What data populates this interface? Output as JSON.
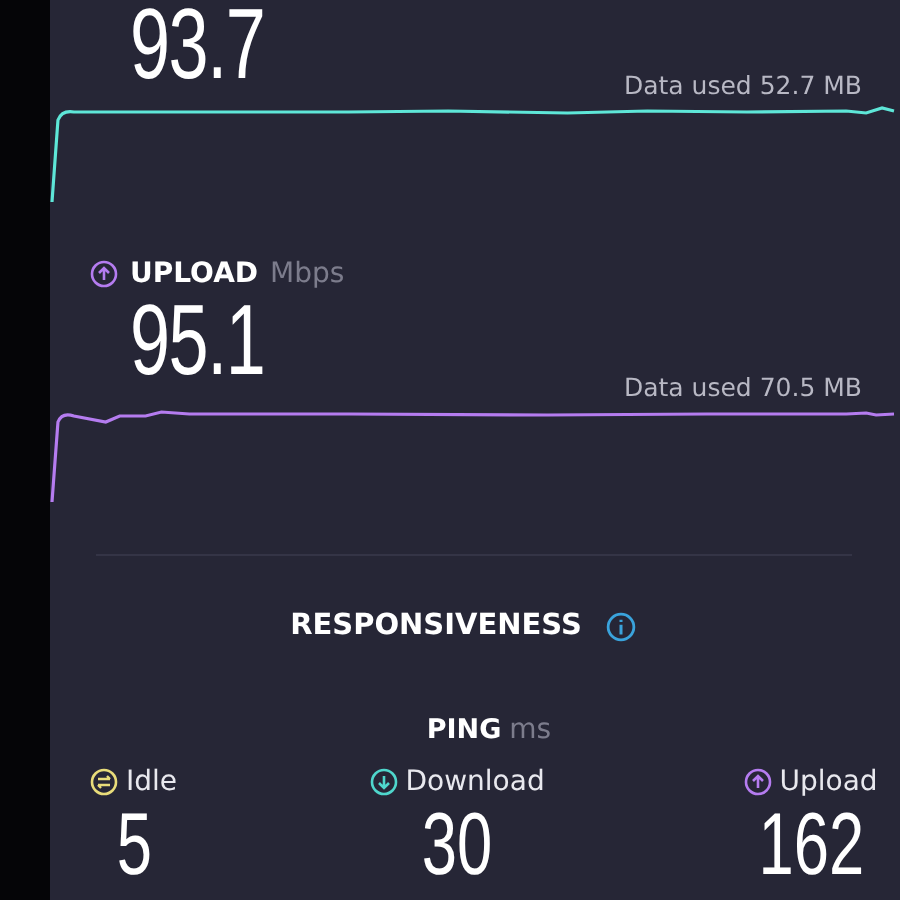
{
  "download": {
    "value": "93.7",
    "data_used": "Data used 52.7 MB"
  },
  "upload": {
    "label": "UPLOAD",
    "unit": "Mbps",
    "value": "95.1",
    "data_used": "Data used 70.5 MB"
  },
  "responsiveness": {
    "title": "RESPONSIVENESS",
    "ping_label": "PING",
    "ping_unit": "ms",
    "items": [
      {
        "kind": "idle",
        "label": "Idle",
        "value": "5"
      },
      {
        "kind": "download",
        "label": "Download",
        "value": "30"
      },
      {
        "kind": "upload",
        "label": "Upload",
        "value": "162"
      }
    ]
  }
}
